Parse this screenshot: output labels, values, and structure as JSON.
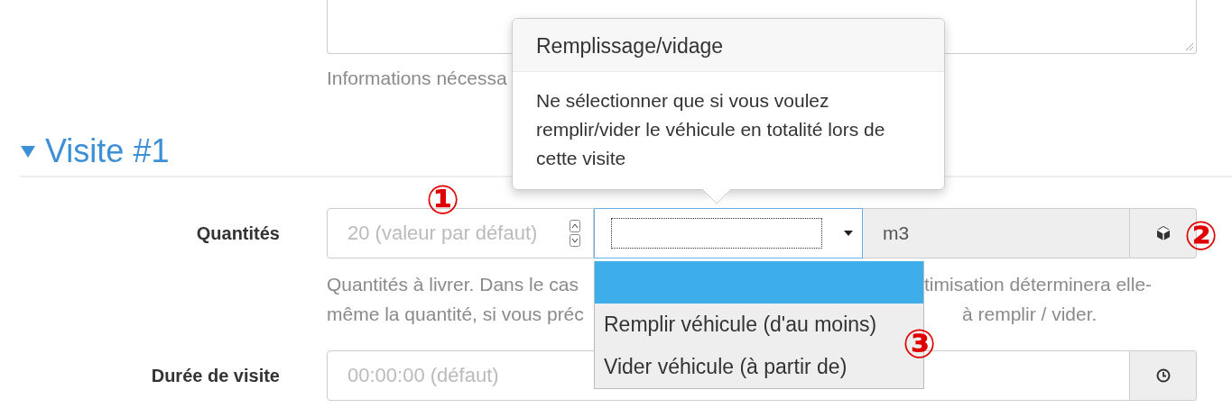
{
  "notes": {
    "help": "Informations nécessa"
  },
  "section": {
    "title": "Visite #1",
    "expanded": true
  },
  "quantities": {
    "label": "Quantités",
    "placeholder": "20 (valeur par défaut)",
    "unit": "m3",
    "help_left": [
      "Quantités à livrer. Dans le cas",
      "même la quantité, si vous préc"
    ],
    "help_right": [
      "timisation déterminera elle-",
      "à remplir / vider."
    ]
  },
  "dropdown": {
    "options": [
      {
        "label": "Remplir véhicule (d'au moins)",
        "selected": false
      },
      {
        "label": "Vider véhicule (à partir de)",
        "selected": false
      }
    ]
  },
  "popover": {
    "title": "Remplissage/vidage",
    "body": "Ne sélectionner que si vous voulez remplir/vider le véhicule en totalité lors de cette visite"
  },
  "duration": {
    "label": "Durée de visite",
    "placeholder": "00:00:00 (défaut)"
  },
  "annotations": [
    "①",
    "②",
    "③"
  ]
}
